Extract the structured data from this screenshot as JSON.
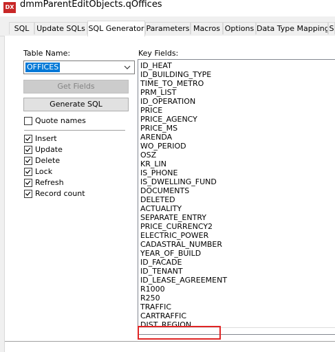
{
  "window": {
    "app_badge": "DX",
    "title": "dmmParentEditObjects.qOffices"
  },
  "tabs": [
    "SQL",
    "Update SQLs",
    "SQL Generator",
    "Parameters",
    "Macros",
    "Options",
    "Data Type Mapping",
    "S"
  ],
  "active_tab": "SQL Generator",
  "left": {
    "table_name_label": "Table Name:",
    "table_name_value": "OFFICES",
    "get_fields_label": "Get Fields",
    "generate_sql_label": "Generate SQL",
    "quote_names": {
      "label": "Quote names",
      "checked": false
    },
    "options": [
      {
        "label": "Insert",
        "checked": true
      },
      {
        "label": "Update",
        "checked": true
      },
      {
        "label": "Delete",
        "checked": true
      },
      {
        "label": "Lock",
        "checked": true
      },
      {
        "label": "Refresh",
        "checked": true
      },
      {
        "label": "Record count",
        "checked": true
      }
    ]
  },
  "key_fields": {
    "label": "Key Fields:",
    "items": [
      "ID_HEAT",
      "ID_BUILDING_TYPE",
      "TIME_TO_METRO",
      "PRM_LIST",
      "ID_OPERATION",
      "PRICE",
      "PRICE_AGENCY",
      "PRICE_MS",
      "ARENDA",
      "WO_PERIOD",
      "OSZ",
      "KR_LIN",
      "IS_PHONE",
      "IS_DWELLING_FUND",
      "DOCUMENTS",
      "DELETED",
      "ACTUALITY",
      "SEPARATE_ENTRY",
      "PRICE_CURRENCY2",
      "ELECTRIC_POWER",
      "CADASTRAL_NUMBER",
      "YEAR_OF_BUILD",
      "ID_FACADE",
      "ID_TENANT",
      "ID_LEASE_AGREEMENT",
      "R1000",
      "R250",
      "TRAFFIC",
      "CARTRAFFIC",
      "DIST_REGION"
    ]
  },
  "colors": {
    "selection": "#0078d7",
    "highlight_annotation": "#e02424",
    "app_badge": "#c82727"
  }
}
